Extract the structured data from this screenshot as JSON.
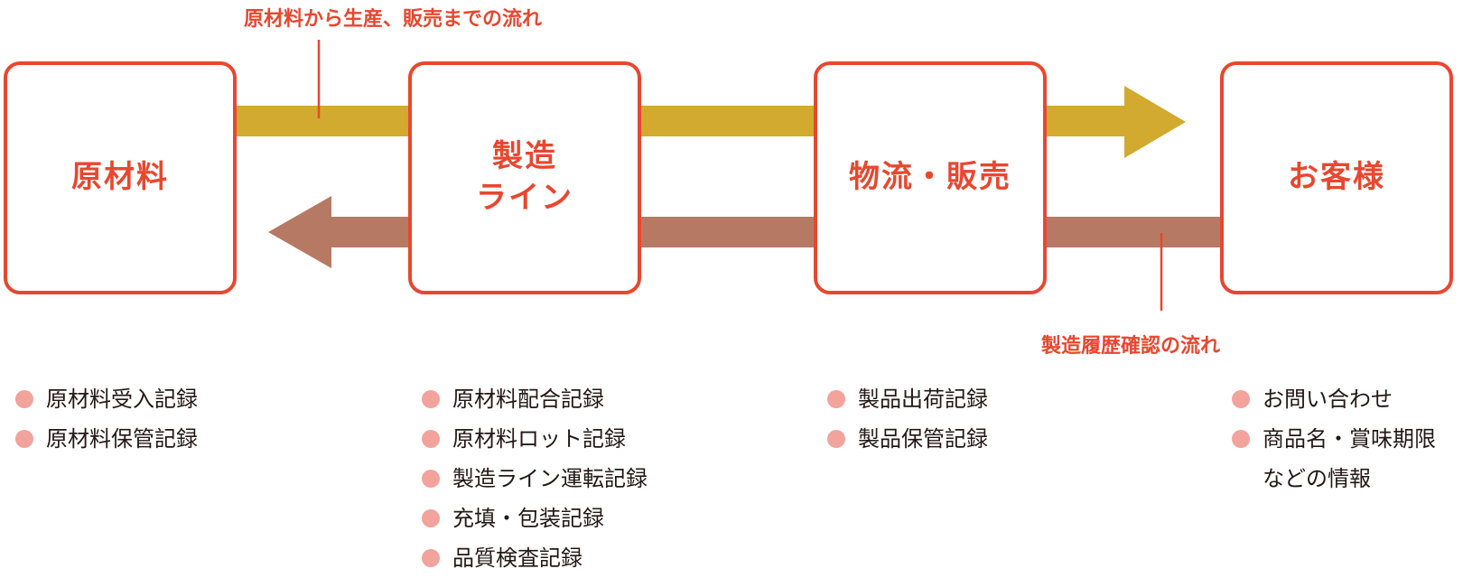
{
  "colors": {
    "accent": "#e8472f",
    "forward_arrow": "#d2aa2f",
    "backward_arrow": "#b67a64",
    "bullet": "#f2a39c",
    "text": "#231815"
  },
  "top_caption": "原材料から生産、販売までの流れ",
  "bottom_caption": "製造履歴確認の流れ",
  "stages": [
    {
      "label": "原材料",
      "items": [
        "原材料受入記録",
        "原材料保管記録"
      ]
    },
    {
      "label": "製造\nライン",
      "items": [
        "原材料配合記録",
        "原材料ロット記録",
        "製造ライン運転記録",
        "充填・包装記録",
        "品質検査記録"
      ]
    },
    {
      "label": "物流・販売",
      "items": [
        "製品出荷記録",
        "製品保管記録"
      ]
    },
    {
      "label": "お客様",
      "items": [
        "お問い合わせ",
        "商品名・賞味期限\nなどの情報"
      ]
    }
  ]
}
